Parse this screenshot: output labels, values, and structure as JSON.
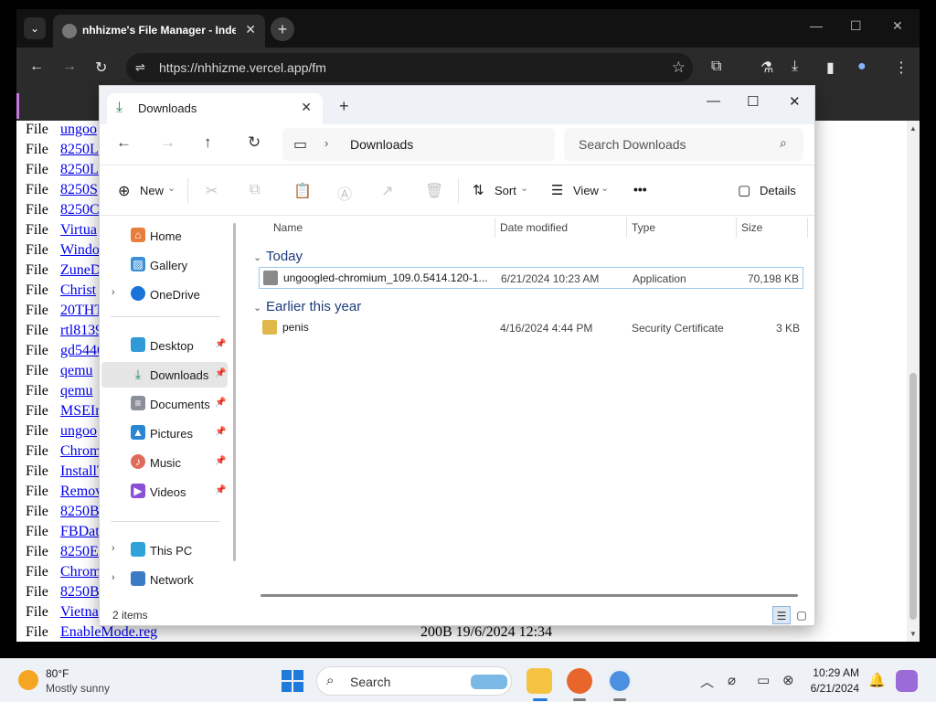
{
  "browser": {
    "tab_list_icon": "⌄",
    "tab_title": "nhhizme's File Manager - Index",
    "tab_close": "✕",
    "new_tab": "+",
    "win_min": "—",
    "win_max": "☐",
    "win_close": "✕",
    "back": "←",
    "forward": "→",
    "reload": "↻",
    "site_info": "⇌",
    "url": "https://nhhizme.vercel.app/fm",
    "bookmark": "☆",
    "extensions": "⧉",
    "labs": "⚗",
    "download": "⤓",
    "sidepanel": "▮",
    "profile": "●",
    "menu": "⋮"
  },
  "page": {
    "rows": [
      {
        "kind": "File",
        "name": "ungoo"
      },
      {
        "kind": "File",
        "name": "8250L"
      },
      {
        "kind": "File",
        "name": "8250L"
      },
      {
        "kind": "File",
        "name": "8250S"
      },
      {
        "kind": "File",
        "name": "8250C"
      },
      {
        "kind": "File",
        "name": "Virtua"
      },
      {
        "kind": "File",
        "name": "Windo"
      },
      {
        "kind": "File",
        "name": "ZuneD"
      },
      {
        "kind": "File",
        "name": "Christ"
      },
      {
        "kind": "File",
        "name": "20THT"
      },
      {
        "kind": "File",
        "name": "rtl8139"
      },
      {
        "kind": "File",
        "name": "gd5446"
      },
      {
        "kind": "File",
        "name": "qemu"
      },
      {
        "kind": "File",
        "name": "qemu"
      },
      {
        "kind": "File",
        "name": "MSEIn"
      },
      {
        "kind": "File",
        "name": "ungoo"
      },
      {
        "kind": "File",
        "name": "Chrom"
      },
      {
        "kind": "File",
        "name": "InstallT"
      },
      {
        "kind": "File",
        "name": "Remov"
      },
      {
        "kind": "File",
        "name": "8250B"
      },
      {
        "kind": "File",
        "name": "FBDat"
      },
      {
        "kind": "File",
        "name": "8250E"
      },
      {
        "kind": "File",
        "name": "Chrom"
      },
      {
        "kind": "File",
        "name": "8250B"
      },
      {
        "kind": "File",
        "name": "Vietna"
      },
      {
        "kind": "File",
        "name": "EnableMode.reg"
      }
    ],
    "last_row_tail": "200B    19/6/2024 12:34"
  },
  "explorer": {
    "tab_label": "Downloads",
    "tab_icon": "⤓",
    "tab_close": "✕",
    "new_tab": "+",
    "win_min": "—",
    "win_max": "☐",
    "win_close": "✕",
    "nav": {
      "back": "←",
      "forward": "→",
      "up": "↑",
      "refresh": "↻"
    },
    "address": {
      "pc_icon": "▭",
      "sep": "›",
      "crumb": "Downloads"
    },
    "search_placeholder": "Search Downloads",
    "search_icon": "⌕",
    "cmd": {
      "new_label": "New",
      "new_icon": "⊕",
      "new_chev": "⌄",
      "cut_icon": "✂",
      "copy_icon": "⧉",
      "paste_icon": "📋",
      "rename_icon": "Ⓐ",
      "share_icon": "↗",
      "delete_icon": "🗑",
      "sort_label": "Sort",
      "sort_icon": "⇅",
      "sort_chev": "⌄",
      "view_label": "View",
      "view_icon": "☰",
      "view_chev": "⌄",
      "more": "•••",
      "details_label": "Details",
      "details_icon": "▢"
    },
    "sidebar": {
      "home": "Home",
      "gallery": "Gallery",
      "onedrive": "OneDrive",
      "desktop": "Desktop",
      "downloads": "Downloads",
      "documents": "Documents",
      "pictures": "Pictures",
      "music": "Music",
      "videos": "Videos",
      "thispc": "This PC",
      "network": "Network",
      "chev": "›",
      "pin": "📌"
    },
    "columns": {
      "name": "Name",
      "date": "Date modified",
      "type": "Type",
      "size": "Size"
    },
    "groups": {
      "today": "Today",
      "earlier": "Earlier this year",
      "chev": "⌄"
    },
    "files": [
      {
        "name": "ungoogled-chromium_109.0.5414.120-1....",
        "date": "6/21/2024 10:23 AM",
        "type": "Application",
        "size": "70,198 KB"
      },
      {
        "name": "penis",
        "date": "4/16/2024 4:44 PM",
        "type": "Security Certificate",
        "size": "3 KB"
      }
    ],
    "status": {
      "count": "2 items",
      "details_view": "☰",
      "tiles_view": "▢"
    }
  },
  "taskbar": {
    "temp": "80°F",
    "condition": "Mostly sunny",
    "search_label": "Search",
    "search_icon": "⌕",
    "tray_chevron": "︿",
    "tray_network": "⌀",
    "tray_display": "▭",
    "tray_copilot": "⊗",
    "tray_volume": "⇋",
    "time": "10:29 AM",
    "date": "6/21/2024",
    "bell": "🔔"
  },
  "colors": {
    "link": "#0000ee",
    "accent": "#1f7ad9",
    "selection_border": "#99c8ee"
  }
}
